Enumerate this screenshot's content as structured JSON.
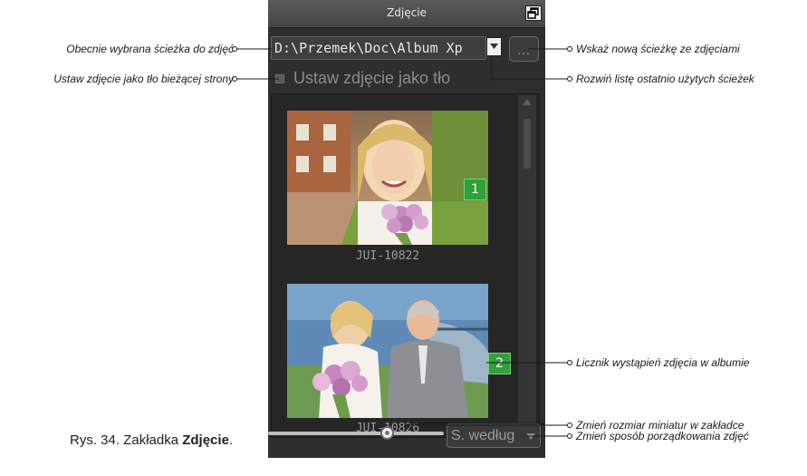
{
  "panel": {
    "title": "Zdjęcie",
    "path_value": "D:\\Przemek\\Doc\\Album Xp",
    "browse_label": "...",
    "checkbox_label": "Ustaw zdjęcie jako tło",
    "thumbnails": [
      {
        "caption": "JUI-10822",
        "count": "1"
      },
      {
        "caption": "JUI-10826",
        "count": "2"
      }
    ],
    "sort_label": "S. według"
  },
  "callouts": {
    "current_path": "Obecnie wybrana ścieżka do zdjęć",
    "set_background": "Ustaw zdjęcie jako tło bieżącej strony",
    "new_path": "Wskaż nową ścieżkę ze zdjęciami",
    "recent_paths": "Rozwiń listę ostatnio użytych ścieżek",
    "occurrence_counter": "Licznik wystąpień zdjęcia w albumie",
    "thumb_size": "Zmień rozmiar miniatur w zakładce",
    "sort_order": "Zmień sposób porządkowania zdjęć"
  },
  "figure_caption": {
    "prefix": "Rys. 34. Zakładka ",
    "bold": "Zdjęcie",
    "suffix": "."
  },
  "icons": {
    "restore": "restore-window-icon",
    "dropdown": "chevron-down-icon",
    "scroll_up": "scroll-up-arrow-icon",
    "scroll_down": "scroll-down-arrow-icon"
  },
  "colors": {
    "panel_bg": "#2e2e2e",
    "badge": "#2fa13a"
  }
}
